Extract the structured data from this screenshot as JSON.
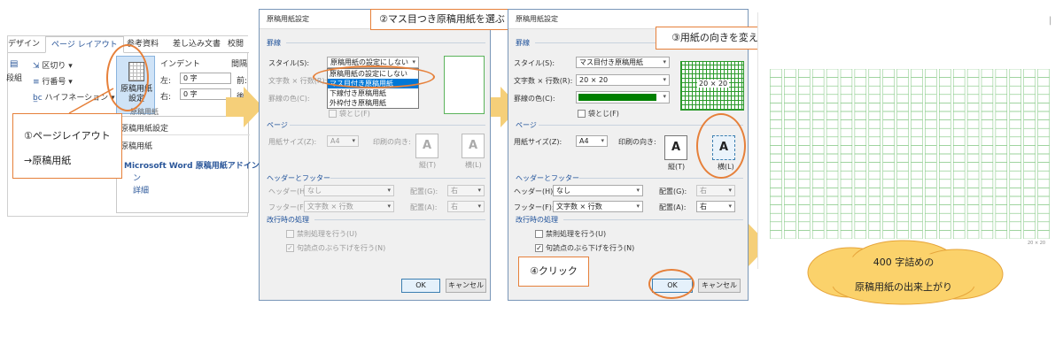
{
  "ribbon": {
    "tabs": [
      "デザイン",
      "ページ レイアウト",
      "参考資料",
      "差し込み文書",
      "校閲"
    ],
    "commands": {
      "breaks": "区切り",
      "line_numbers": "行番号",
      "hyphenation": "ハイフネーション",
      "orientation_partial": "段組"
    },
    "genko_button_label": "原稿用紙\n設定",
    "indent_header": "インデント",
    "spacing_header": "間隔",
    "indent_left_label": "左:",
    "indent_left_value": "0 字",
    "indent_right_label": "右:",
    "indent_right_value": "0 字",
    "spacing_before_partial": "前:",
    "spacing_after_partial": "後:",
    "group_label_partial": "原稿用紙",
    "dropdown": {
      "heading": "原稿用紙設定",
      "item_genko": "原稿用紙",
      "addin_title": "Microsoft Word 原稿用紙アドイン",
      "addin_detail": "詳細"
    },
    "arrange_label_partial": "段"
  },
  "callout1": {
    "line1": "①ページレイアウト",
    "line2": "→原稿用紙"
  },
  "callout2": {
    "text": "②マス目つき原稿用紙を選ぶ"
  },
  "callout3": {
    "text": "③用紙の向きを変えましょう"
  },
  "callout4": {
    "text": "④クリック"
  },
  "cloud": {
    "line1": "400 字詰めの",
    "line2": "原稿用紙の出来上がり"
  },
  "dialog2": {
    "title": "原稿用紙設定",
    "section_lines": "罫線",
    "style_label": "スタイル(S):",
    "style_value": "原稿用紙の設定にしない",
    "style_options": [
      "原稿用紙の設定にしない",
      "マス目付き原稿用紙",
      "下線付き原稿用紙",
      "外枠付き原稿用紙"
    ],
    "chars_label": "文字数 × 行数(R):",
    "color_label": "罫線の色(C):",
    "fold_label": "袋とじ(F)",
    "section_page": "ページ",
    "paper_size_label": "用紙サイズ(Z):",
    "paper_size_value": "A4",
    "orientation_label": "印刷の向き:",
    "portrait_label": "縦(T)",
    "landscape_label": "横(L)",
    "section_header": "ヘッダーとフッター",
    "header_label": "ヘッダー(H):",
    "header_value": "なし",
    "header_pos_label": "配置(G):",
    "header_pos_value": "右",
    "footer_label": "フッター(F):",
    "footer_value": "文字数 × 行数",
    "footer_pos_label": "配置(A):",
    "footer_pos_value": "右",
    "section_break": "改行時の処理",
    "kinsoku_label": "禁則処理を行う(U)",
    "burasage_label": "句読点のぶら下げを行う(N)",
    "ok_label": "OK",
    "cancel_label": "キャンセル"
  },
  "dialog3": {
    "title": "原稿用紙設定",
    "section_lines": "罫線",
    "style_label": "スタイル(S):",
    "style_value": "マス目付き原稿用紙",
    "chars_label": "文字数 × 行数(R):",
    "chars_value": "20 × 20",
    "preview_label": "20 × 20",
    "color_label": "罫線の色(C):",
    "line_color": "#008000",
    "fold_label": "袋とじ(F)",
    "section_page": "ページ",
    "paper_size_label": "用紙サイズ(Z):",
    "paper_size_value": "A4",
    "orientation_label": "印刷の向き:",
    "portrait_label": "縦(T)",
    "landscape_label": "横(L)",
    "section_header": "ヘッダーとフッター",
    "header_label": "ヘッダー(H):",
    "header_value": "なし",
    "header_pos_label": "配置(G):",
    "header_pos_value": "右",
    "footer_label": "フッター(F):",
    "footer_value": "文字数 × 行数",
    "footer_pos_label": "配置(A):",
    "footer_pos_value": "右",
    "section_break": "改行時の処理",
    "kinsoku_label": "禁則処理を行う(U)",
    "burasage_label": "句読点のぶら下げを行う(N)",
    "burasage_checked": true,
    "ok_label": "OK",
    "cancel_label": "キャンセル"
  },
  "manuscript": {
    "grid_cols": 20,
    "grid_rows": 20,
    "grid_color": "#7ac47a",
    "footer_text": "20 × 20"
  },
  "colors": {
    "accent_orange": "#e6803a",
    "arrow_yellow": "#f5cf79",
    "cloud_yellow": "#fbd26b",
    "ribbon_blue": "#2b579a"
  }
}
